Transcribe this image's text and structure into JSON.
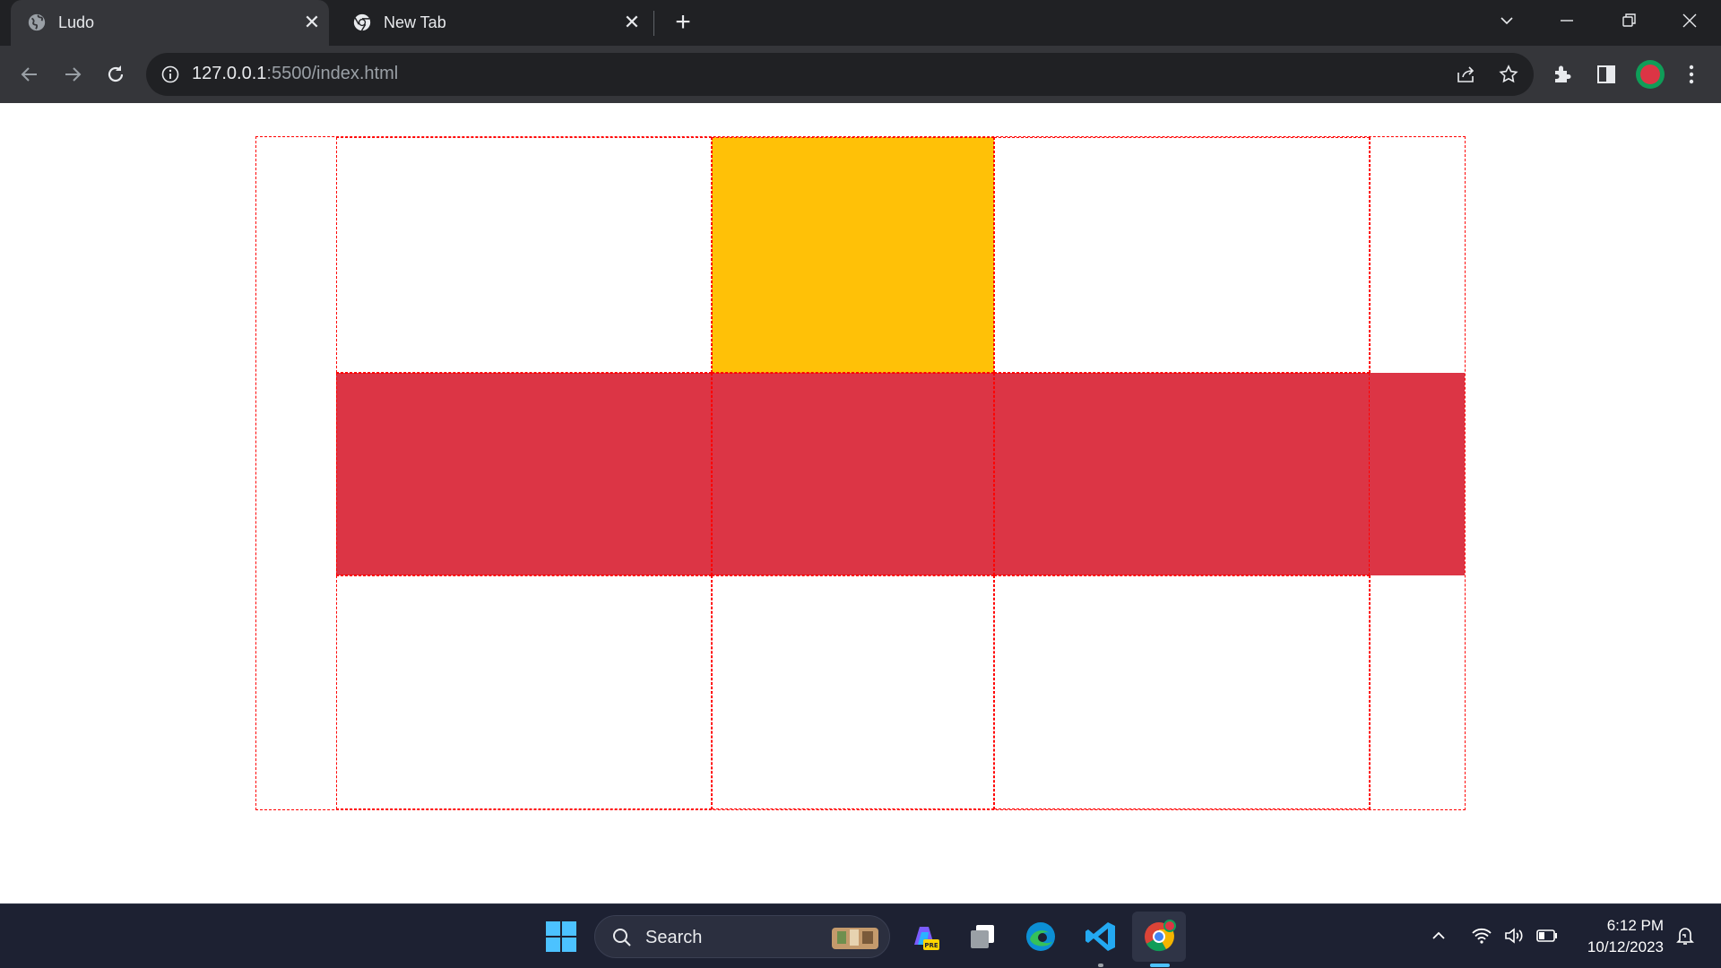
{
  "browser": {
    "tabs": [
      {
        "title": "Ludo",
        "favicon": "globe-icon",
        "active": true
      },
      {
        "title": "New Tab",
        "favicon": "chrome-icon",
        "active": false
      }
    ],
    "address_bar": {
      "host": "127.0.0.1",
      "rest": ":5500/index.html"
    }
  },
  "page": {
    "board": {
      "colors": {
        "yellow": "#ffc107",
        "red": "#dc3545",
        "border": "#ff0000"
      },
      "rows": [
        [
          "white",
          "yellow",
          "white"
        ],
        [
          "red",
          "red",
          "red",
          "red"
        ],
        [
          "white",
          "white",
          "white"
        ]
      ]
    }
  },
  "taskbar": {
    "search_placeholder": "Search",
    "pinned": [
      "start-icon",
      "copilot-icon",
      "task-view-icon",
      "edge-icon",
      "vscode-icon",
      "chrome-icon"
    ],
    "clock": {
      "time": "6:12 PM",
      "date": "10/12/2023"
    }
  }
}
